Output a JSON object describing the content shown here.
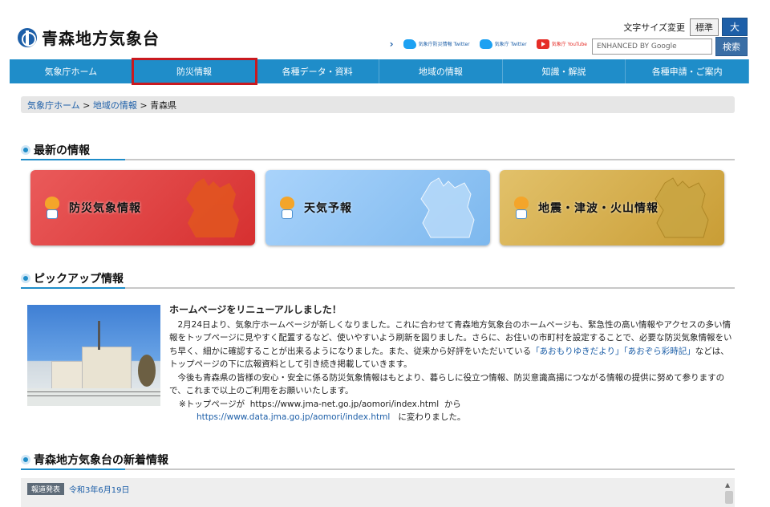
{
  "header": {
    "site_title": "青森地方気象台",
    "font_size_label": "文字サイズ変更",
    "font_std": "標準",
    "font_large": "大",
    "social": [
      {
        "icon": "twitter-icon",
        "text": "気象庁防災情報 Twitter"
      },
      {
        "icon": "twitter-icon",
        "text": "気象庁 Twitter"
      },
      {
        "icon": "youtube-icon",
        "text": "気象庁 YouTube"
      }
    ],
    "search_placeholder": "ENHANCED BY Google",
    "search_button": "検索"
  },
  "nav": {
    "items": [
      "気象庁ホーム",
      "防災情報",
      "各種データ・資料",
      "地域の情報",
      "知識・解説",
      "各種申請・ご案内"
    ]
  },
  "breadcrumb": {
    "items": [
      "気象庁ホーム",
      "地域の情報"
    ],
    "current": "青森県",
    "sep": " > "
  },
  "sections": {
    "latest": "最新の情報",
    "pickup": "ピックアップ情報",
    "news": "青森地方気象台の新着情報"
  },
  "cards": [
    {
      "label": "防災気象情報",
      "color": "#d93a3a"
    },
    {
      "label": "天気予報",
      "color": "#8cc3f3"
    },
    {
      "label": "地震・津波・火山情報",
      "color": "#d4ae4b"
    }
  ],
  "pickup": {
    "title": "ホームページをリニューアルしました！",
    "p1": "2月24日より、気象庁ホームページが新しくなりました。これに合わせて青森地方気象台のホームページも、緊急性の高い情報やアクセスの多い情報をトップページに見やすく配置するなど、使いやすいよう刷新を図りました。さらに、お住いの市町村を設定することで、必要な防災気象情報をいち早く、細かに確認することが出来るようになりました。また、従来から好評をいただいている",
    "p1_link": "「あおもりゆきだより」「あおぞら彩時記」",
    "p1_end": "などは、トップページの下に広報資料として引き続き掲載していきます。",
    "p2": "今後も青森県の皆様の安心・安全に係る防災気象情報はもとより、暮らしに役立つ情報、防災意識高揚につながる情報の提供に努めて参りますので、これまで以上のご利用をお願いいたします。",
    "note_prefix": "※トップページが",
    "old_url": "https://www.jma-net.go.jp/aomori/index.html",
    "note_mid": "から",
    "new_url": "https://www.data.jma.go.jp/aomori/index.html",
    "note_end": "に変わりました。"
  },
  "news": {
    "badge": "報道発表",
    "date": "令和3年6月19日"
  }
}
